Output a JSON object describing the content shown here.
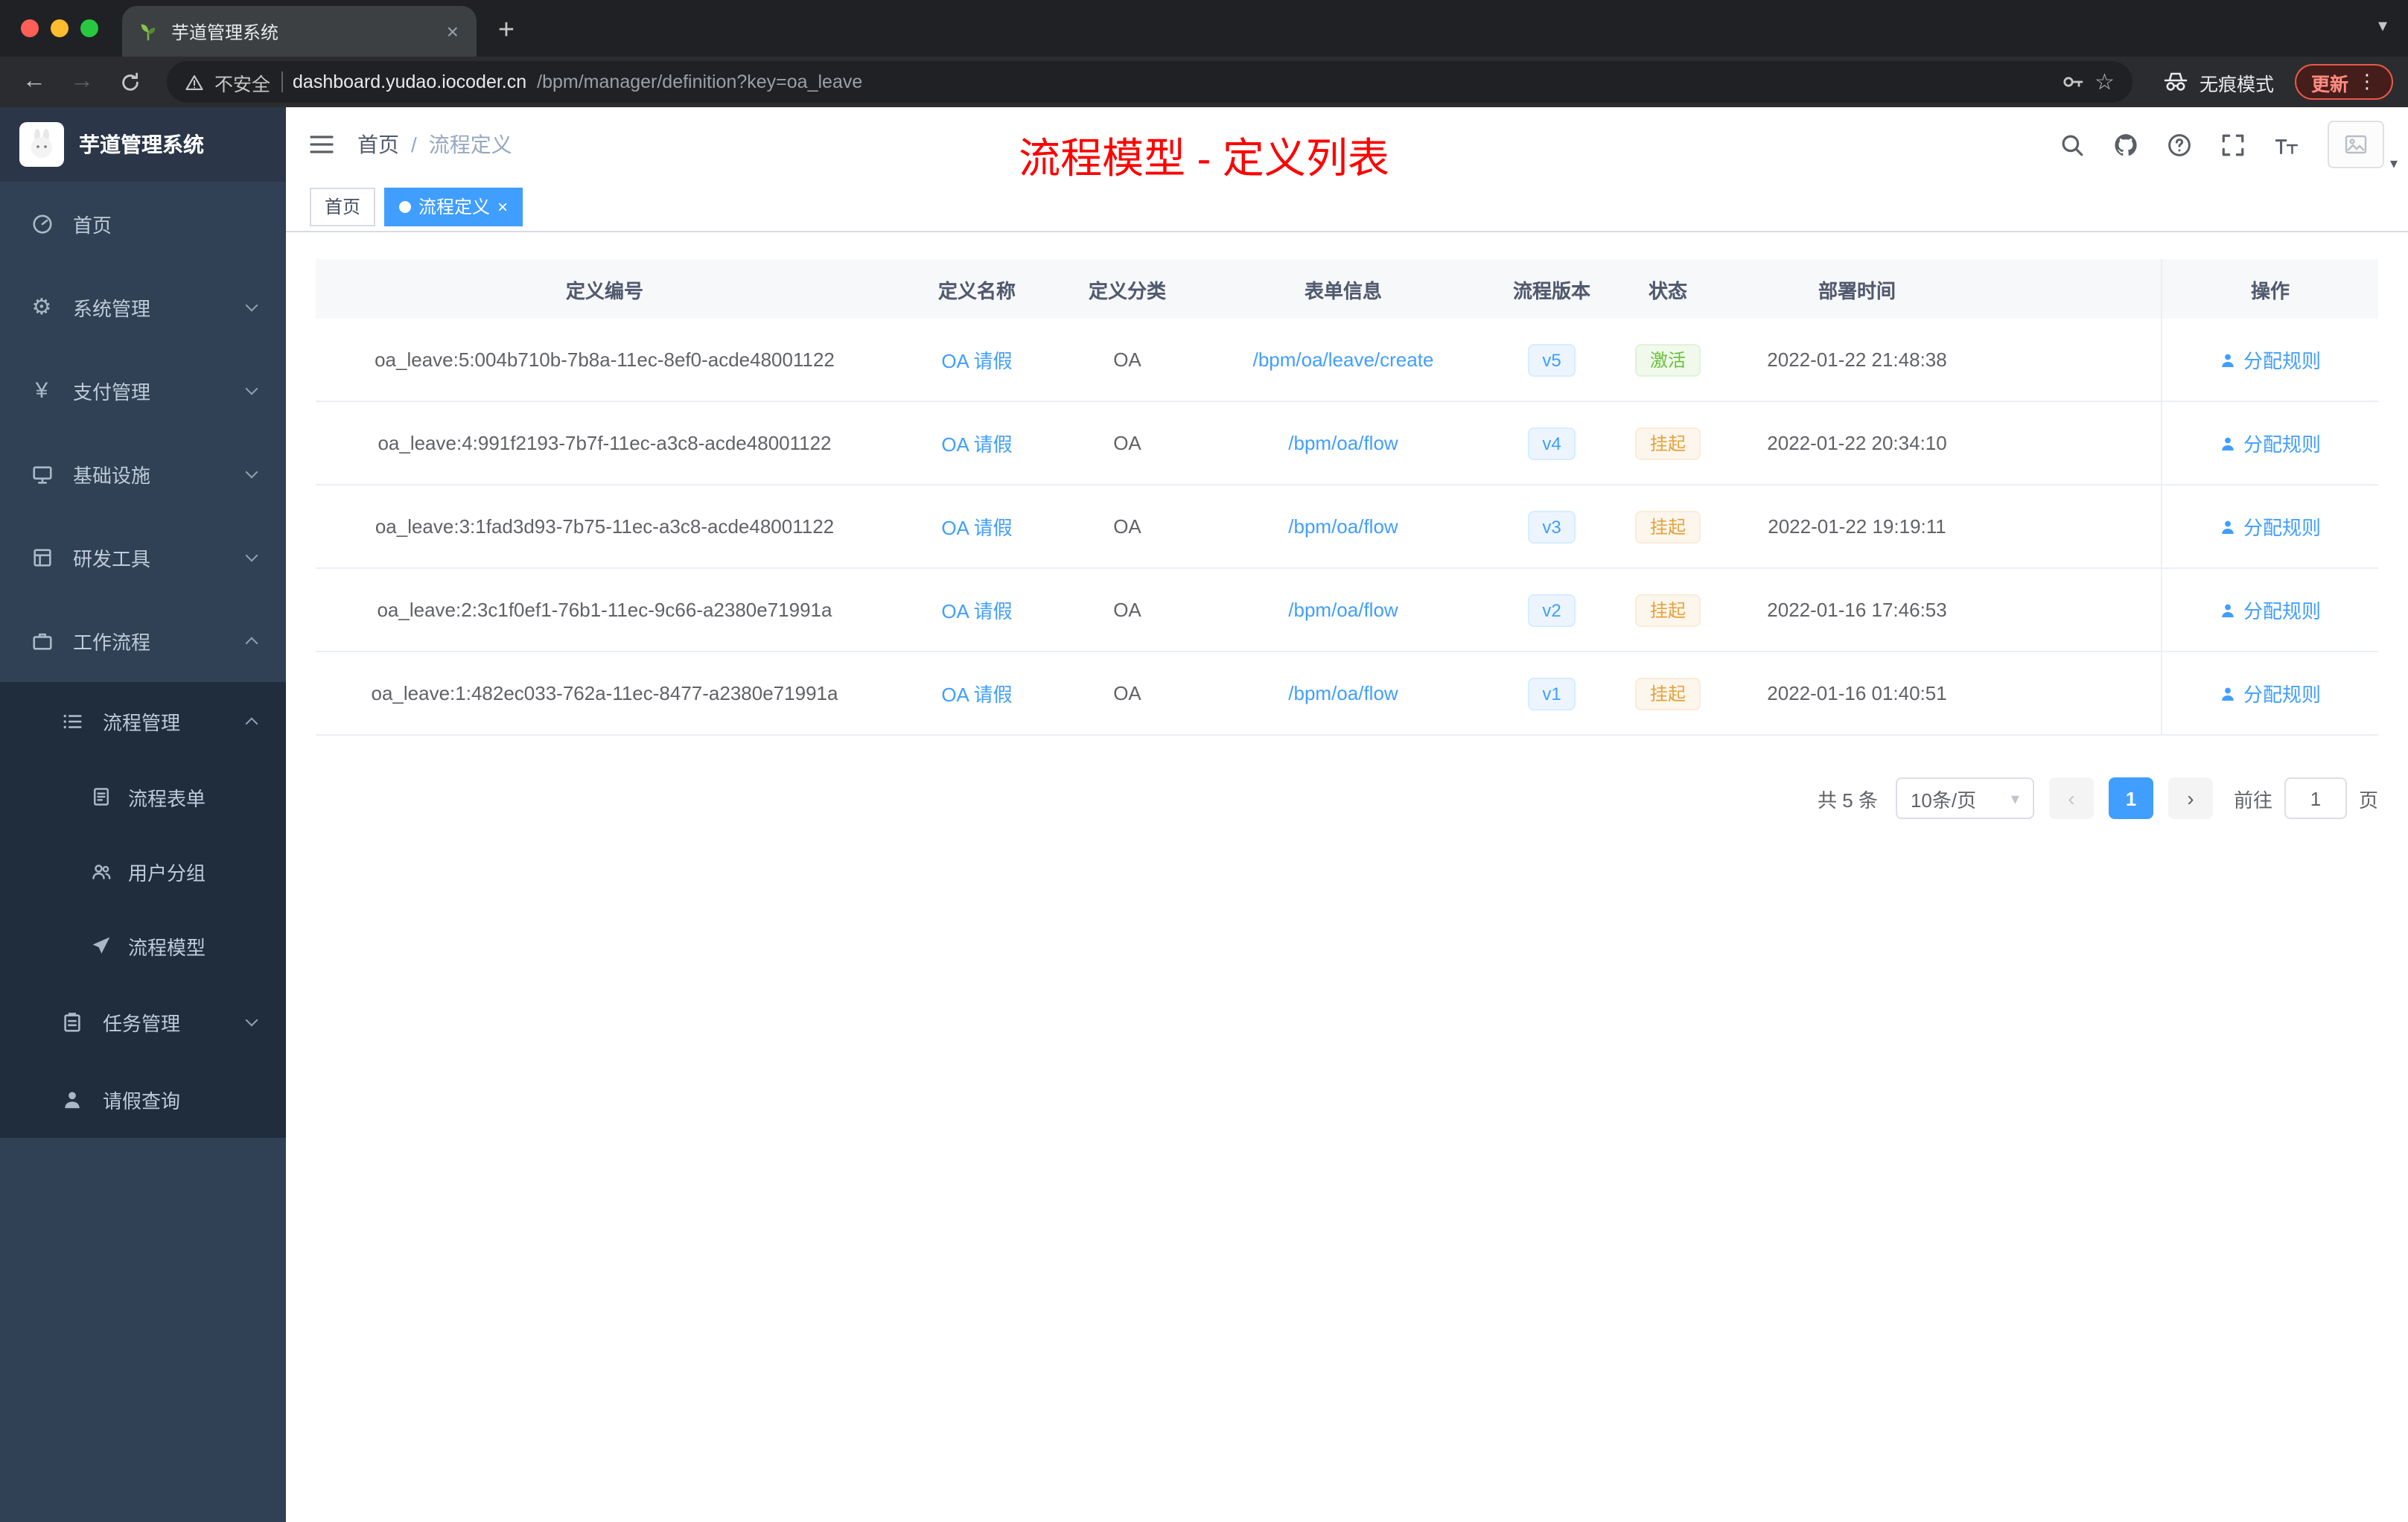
{
  "colors": {
    "accent": "#409EFF",
    "title_red": "#FE0000",
    "success": "#67C23A",
    "warning": "#E6A23C"
  },
  "icons": {
    "close": "×",
    "plus": "+",
    "caret_down": "▾",
    "back": "←",
    "forward": "→",
    "star": "☆",
    "kebab": "⋮",
    "gear": "⚙",
    "yen": "¥",
    "prev": "‹",
    "next": "›"
  },
  "browser": {
    "tab_title": "芋道管理系统",
    "not_secure_label": "不安全",
    "url_host": "dashboard.yudao.iocoder.cn",
    "url_path": "/bpm/manager/definition?key=oa_leave",
    "incognito_label": "无痕模式",
    "update_label": "更新"
  },
  "sidebar": {
    "logo_title": "芋道管理系统",
    "menu": [
      {
        "label": "首页"
      },
      {
        "label": "系统管理"
      },
      {
        "label": "支付管理"
      },
      {
        "label": "基础设施"
      },
      {
        "label": "研发工具"
      },
      {
        "label": "工作流程"
      },
      {
        "label": "流程管理"
      },
      {
        "label": "流程表单"
      },
      {
        "label": "用户分组"
      },
      {
        "label": "流程模型"
      },
      {
        "label": "任务管理"
      },
      {
        "label": "请假查询"
      }
    ]
  },
  "navbar": {
    "breadcrumb_home": "首页",
    "breadcrumb_sep": "/",
    "breadcrumb_current": "流程定义",
    "page_title": "流程模型 - 定义列表"
  },
  "tags": {
    "home": "首页",
    "current": "流程定义"
  },
  "table": {
    "columns": [
      "定义编号",
      "定义名称",
      "定义分类",
      "表单信息",
      "流程版本",
      "状态",
      "部署时间",
      "操作"
    ],
    "rows": [
      {
        "id": "oa_leave:5:004b710b-7b8a-11ec-8ef0-acde48001122",
        "name": "OA 请假",
        "category": "OA",
        "form": "/bpm/oa/leave/create",
        "version": "v5",
        "status": "激活",
        "time": "2022-01-22 21:48:38",
        "action": "分配规则"
      },
      {
        "id": "oa_leave:4:991f2193-7b7f-11ec-a3c8-acde48001122",
        "name": "OA 请假",
        "category": "OA",
        "form": "/bpm/oa/flow",
        "version": "v4",
        "status": "挂起",
        "time": "2022-01-22 20:34:10",
        "action": "分配规则"
      },
      {
        "id": "oa_leave:3:1fad3d93-7b75-11ec-a3c8-acde48001122",
        "name": "OA 请假",
        "category": "OA",
        "form": "/bpm/oa/flow",
        "version": "v3",
        "status": "挂起",
        "time": "2022-01-22 19:19:11",
        "action": "分配规则"
      },
      {
        "id": "oa_leave:2:3c1f0ef1-76b1-11ec-9c66-a2380e71991a",
        "name": "OA 请假",
        "category": "OA",
        "form": "/bpm/oa/flow",
        "version": "v2",
        "status": "挂起",
        "time": "2022-01-16 17:46:53",
        "action": "分配规则"
      },
      {
        "id": "oa_leave:1:482ec033-762a-11ec-8477-a2380e71991a",
        "name": "OA 请假",
        "category": "OA",
        "form": "/bpm/oa/flow",
        "version": "v1",
        "status": "挂起",
        "time": "2022-01-16 01:40:51",
        "action": "分配规则"
      }
    ]
  },
  "pagination": {
    "total": "共 5 条",
    "page_size": "10条/页",
    "current_page": "1",
    "goto_label": "前往",
    "goto_value": "1",
    "unit_label": "页"
  }
}
